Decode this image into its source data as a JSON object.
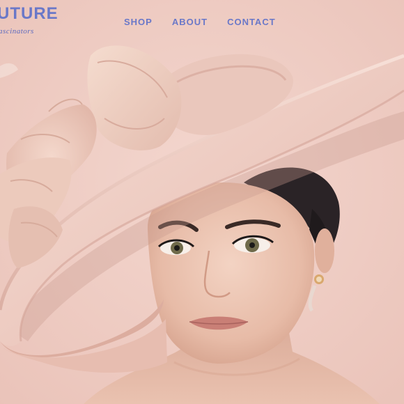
{
  "brand": {
    "title": "UTURE",
    "tagline": "ascinators"
  },
  "nav": {
    "items": [
      {
        "label": "SHOP"
      },
      {
        "label": "ABOUT"
      },
      {
        "label": "CONTACT"
      }
    ]
  },
  "colors": {
    "accent": "#6a78c8",
    "background": "#f1cfc6"
  }
}
